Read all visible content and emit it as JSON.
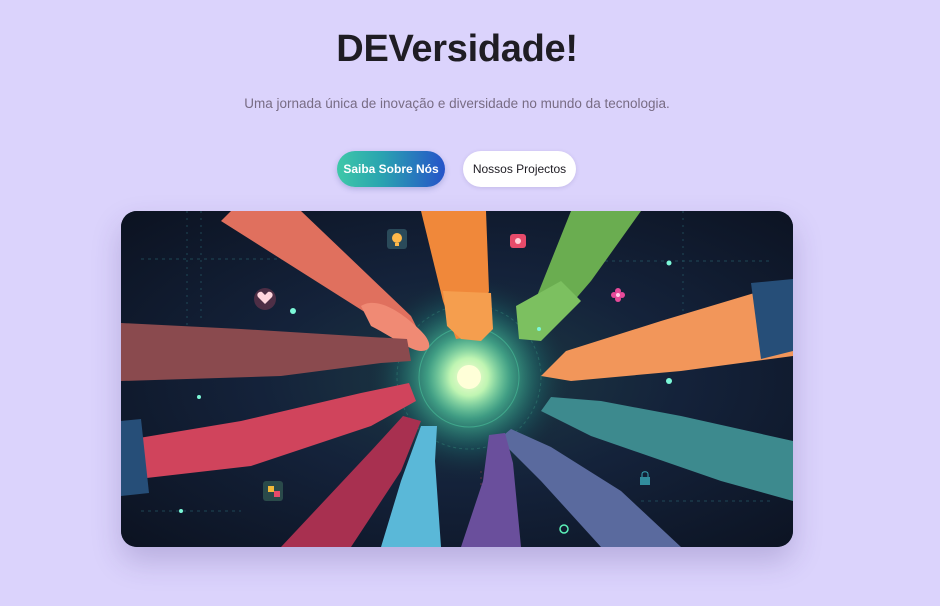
{
  "hero": {
    "title": "DEVersidade!",
    "subtitle": "Uma jornada única de inovação e diversidade no mundo da tecnologia."
  },
  "buttons": {
    "primary_label": "Saiba Sobre Nós",
    "secondary_label": "Nossos Projectos"
  },
  "image": {
    "alt": "Mãos diversas unidas em torno de uma luz tecnológica",
    "icons": [
      "heart-icon",
      "lightbulb-icon",
      "chat-icon",
      "flower-icon",
      "puzzle-icon",
      "lock-icon",
      "gear-icon"
    ]
  },
  "colors": {
    "background": "#dbd3fc",
    "title": "#1f1d24",
    "subtitle": "#786c84",
    "button_gradient_start": "#3ec8a8",
    "button_gradient_end": "#2653c9",
    "button_secondary_bg": "#ffffff",
    "glow": "#9dffd0"
  }
}
